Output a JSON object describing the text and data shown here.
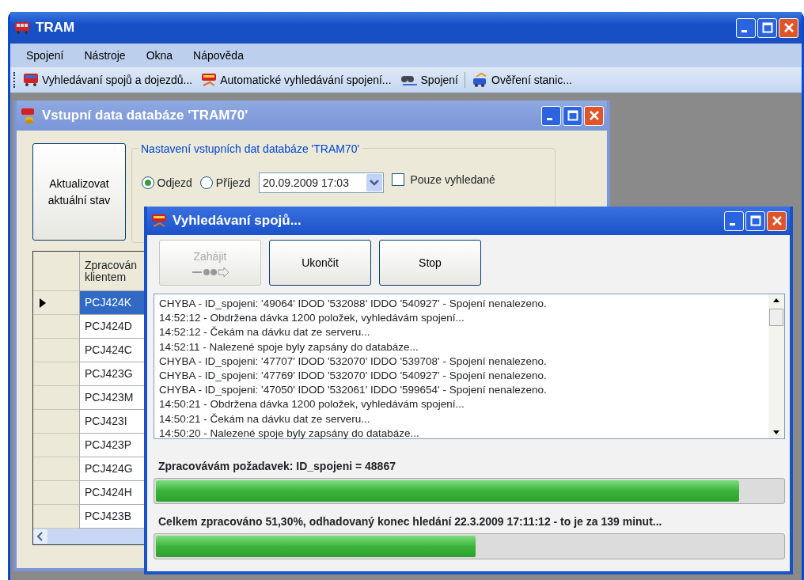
{
  "window": {
    "title": "TRAM"
  },
  "menu": [
    "Spojení",
    "Nástroje",
    "Okna",
    "Nápověda"
  ],
  "toolbar": [
    {
      "label": "Vyhledávaní spojů a  dojezdů...",
      "kind": "bus"
    },
    {
      "label": "Automatické vyhledávání spojení...",
      "kind": "auto"
    },
    {
      "label": "Spojení",
      "kind": "binoculars"
    },
    {
      "label": "Ověření stanic...",
      "kind": "stations",
      "separator_before": true
    }
  ],
  "input_window": {
    "title": "Vstupní data databáze 'TRAM70'",
    "refresh_button": "Aktualizovat aktuální stav",
    "group_title": "Nastavení vstupních dat databáze 'TRAM70'",
    "radios": [
      {
        "label": "Odjezd",
        "selected": true
      },
      {
        "label": "Příjezd",
        "selected": false
      }
    ],
    "datetime": "20.09.2009 17:03",
    "only_found": {
      "label": "Pouze vyhledané",
      "checked": false
    },
    "grid": {
      "column_header": "Zpracován klientem",
      "rows": [
        {
          "value": "PCJ424K",
          "selected": true
        },
        {
          "value": "PCJ424D",
          "selected": false
        },
        {
          "value": "PCJ424C",
          "selected": false
        },
        {
          "value": "PCJ423G",
          "selected": false
        },
        {
          "value": "PCJ423M",
          "selected": false
        },
        {
          "value": "PCJ423I",
          "selected": false
        },
        {
          "value": "PCJ423P",
          "selected": false
        },
        {
          "value": "PCJ424G",
          "selected": false
        },
        {
          "value": "PCJ424H",
          "selected": false
        },
        {
          "value": "PCJ423B",
          "selected": false
        }
      ]
    }
  },
  "search_window": {
    "title": "Vyhledávaní spojů...",
    "buttons": [
      {
        "label": "Zahájit",
        "disabled": true,
        "kind": "start"
      },
      {
        "label": "Ukončit",
        "disabled": false
      },
      {
        "label": "Stop",
        "disabled": false
      }
    ],
    "log": [
      "CHYBA - ID_spojeni: '49064' IDOD '532088' IDDO '540927' -  Spojení nenalezeno.",
      "14:52:12 - Obdržena dávka 1200 položek, vyhledávám spojení...",
      "14:52:12 - Čekám na dávku dat ze serveru...",
      "14:52:11 - Nalezené spoje byly zapsány do databáze...",
      "CHYBA - ID_spojeni: '47707' IDOD '532070' IDDO '539708' -  Spojení nenalezeno.",
      "CHYBA - ID_spojeni: '47769' IDOD '532070' IDDO '540927' -  Spojení nenalezeno.",
      "CHYBA - ID_spojeni: '47050' IDOD '532061' IDDO '599654' -  Spojení nenalezeno.",
      "14:50:21 - Obdržena dávka 1200 položek, vyhledávám spojení...",
      "14:50:21 - Čekám na dávku dat ze serveru...",
      "14:50:20 - Nalezené spoje byly zapsány do databáze..."
    ],
    "progress": [
      {
        "label": "Zpracovávám požadavek: ID_spojeni = 48867",
        "level": 0.93
      },
      {
        "label": "Celkem zpracováno 51,30%, odhadovaný konec hledání 22.3.2009 17:11:12 - to je za 139 minut...",
        "level": 0.51
      }
    ]
  }
}
